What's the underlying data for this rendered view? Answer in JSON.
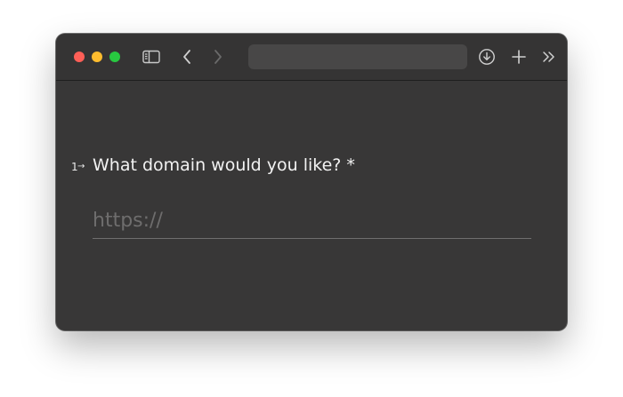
{
  "window": {
    "traffic_lights": [
      {
        "name": "close",
        "color": "#fe5f57"
      },
      {
        "name": "minimize",
        "color": "#febc2e"
      },
      {
        "name": "zoom",
        "color": "#28c840"
      }
    ],
    "background_color": "#383737",
    "toolbar_color": "#353434"
  },
  "toolbar": {
    "icons": [
      "sidebar-icon",
      "chevron-left-icon",
      "chevron-right-icon",
      "download-icon",
      "plus-icon",
      "double-chevron-right-icon"
    ],
    "address": ""
  },
  "form": {
    "question_number": "1",
    "question_arrow": "→",
    "question": "What domain would you like? *",
    "answer_value": "",
    "answer_placeholder": "https://"
  }
}
